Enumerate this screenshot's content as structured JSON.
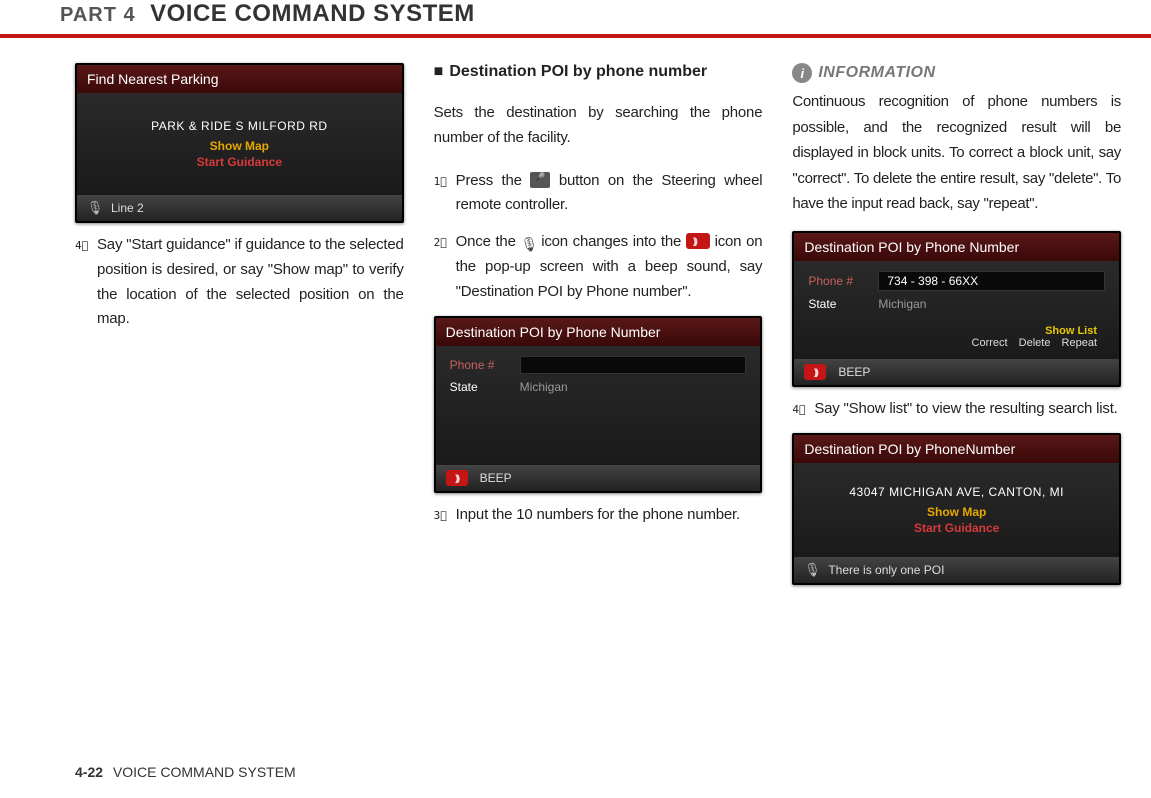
{
  "header": {
    "part": "PART 4",
    "title": "VOICE COMMAND SYSTEM"
  },
  "col1": {
    "screen": {
      "title": "Find Nearest Parking",
      "address": "PARK & RIDE S MILFORD RD",
      "showMap": "Show Map",
      "startGuidance": "Start Guidance",
      "footer": "Line 2"
    },
    "step4": "Say \"Start guidance\" if guidance to the selected position is desired, or say \"Show map\" to verify the location of the selected position on the map."
  },
  "col2": {
    "heading": "Destination POI by phone number",
    "desc": "Sets the destination by searching the phone number of the facility.",
    "step1a": "Press the ",
    "step1b": " button on the Steering wheel remote controller.",
    "step2a": "Once the ",
    "step2b": " icon changes into the ",
    "step2c": " icon on the pop-up screen with a beep sound, say \"Destination POI by Phone number\".",
    "screen": {
      "title": "Destination POI by Phone Number",
      "phoneLabel": "Phone #",
      "phoneValue": "",
      "stateLabel": "State",
      "stateValue": "Michigan",
      "footer": "BEEP"
    },
    "step3": "Input the 10 numbers for the phone number."
  },
  "col3": {
    "infoLabel": "INFORMATION",
    "infoText": "Continuous recognition of phone numbers is possible, and the recognized result will be displayed in block units. To correct a block unit, say \"correct\". To delete the entire result, say \"delete\". To have the input read back, say \"repeat\".",
    "screen1": {
      "title": "Destination POI by Phone Number",
      "phoneLabel": "Phone #",
      "phoneValue": "734 - 398 - 66XX",
      "stateLabel": "State",
      "stateValue": "Michigan",
      "showList": "Show List",
      "correct": "Correct",
      "delete": "Delete",
      "repeat": "Repeat",
      "footer": "BEEP"
    },
    "step4": "Say \"Show list\" to view the resulting search list.",
    "screen2": {
      "title": "Destination POI by PhoneNumber",
      "address": "43047 MICHIGAN AVE, CANTON, MI",
      "showMap": "Show Map",
      "startGuidance": "Start Guidance",
      "footer": "There is only one POI"
    }
  },
  "footer": {
    "pageNum": "4-22",
    "label": "VOICE COMMAND SYSTEM"
  }
}
